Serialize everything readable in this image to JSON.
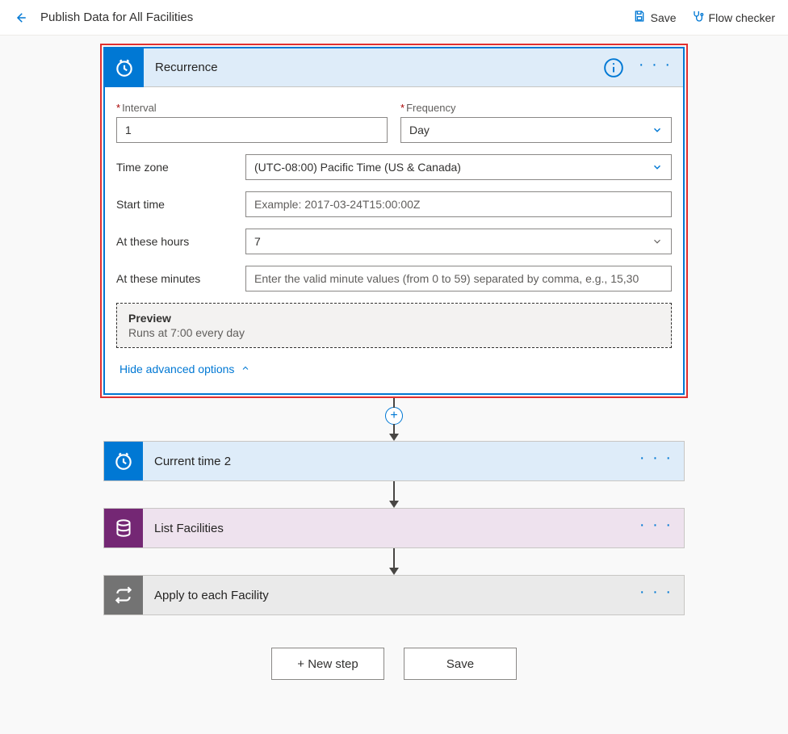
{
  "colors": {
    "accent": "#0078d4",
    "highlight": "#e12f2f"
  },
  "header": {
    "title": "Publish Data for All Facilities",
    "save_label": "Save",
    "checker_label": "Flow checker"
  },
  "recurrence": {
    "title": "Recurrence",
    "interval_label": "Interval",
    "interval_value": "1",
    "frequency_label": "Frequency",
    "frequency_value": "Day",
    "timezone_label": "Time zone",
    "timezone_value": "(UTC-08:00) Pacific Time (US & Canada)",
    "start_time_label": "Start time",
    "start_time_placeholder": "Example: 2017-03-24T15:00:00Z",
    "hours_label": "At these hours",
    "hours_value": "7",
    "minutes_label": "At these minutes",
    "minutes_placeholder": "Enter the valid minute values (from 0 to 59) separated by comma, e.g., 15,30",
    "preview_title": "Preview",
    "preview_text": "Runs at 7:00 every day",
    "adv_toggle_label": "Hide advanced options"
  },
  "steps": {
    "current_time": "Current time 2",
    "list_facilities": "List Facilities",
    "apply_each": "Apply to each Facility"
  },
  "footer": {
    "new_step": "+ New step",
    "save": "Save"
  }
}
